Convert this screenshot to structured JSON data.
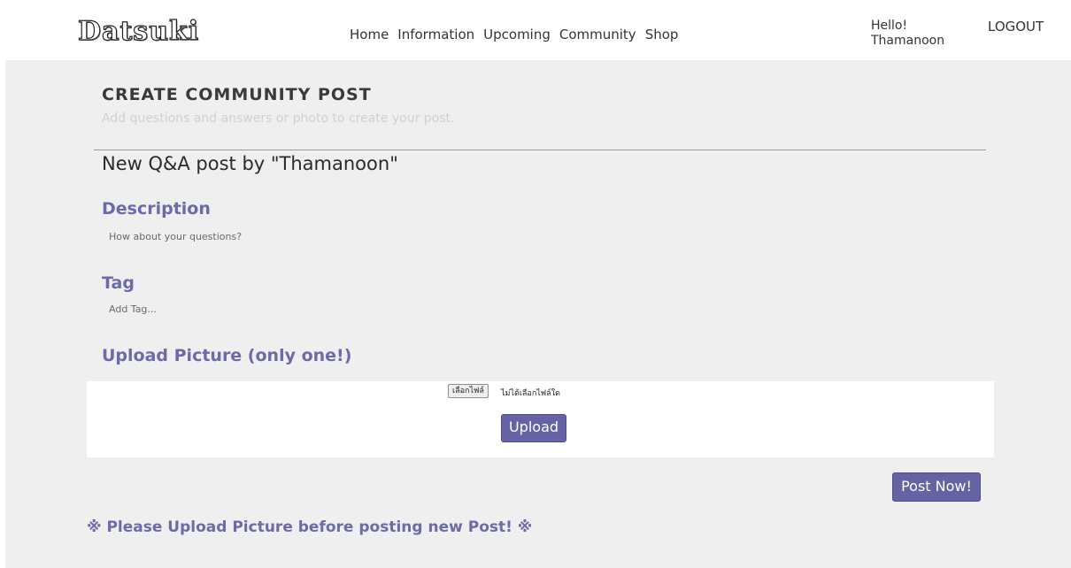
{
  "header": {
    "logo": "Datsuki",
    "nav": [
      "Home",
      "Information",
      "Upcoming",
      "Community",
      "Shop"
    ],
    "greeting_line1": "Hello!",
    "greeting_line2": "Thamanoon",
    "logout": "LOGOUT"
  },
  "page": {
    "title": "Create Community Post",
    "subtitle": "Add questions and answers or photo to create your post.",
    "post_by": "New Q&A post by \"Thamanoon\""
  },
  "form": {
    "description_label": "Description",
    "description_placeholder": "How about your questions?",
    "tag_label": "Tag",
    "tag_placeholder": "Add Tag...",
    "upload_label": "Upload Picture (only one!)",
    "file_button": "เลือกไฟล์",
    "file_status": "ไม่ได้เลือกไฟล์ใด",
    "upload_button": "Upload",
    "post_button": "Post Now!"
  },
  "warning": "※ Please Upload Picture before posting new Post! ※",
  "colors": {
    "accent": "#6563a4",
    "label": "#6d6aaa",
    "panel": "#efefef"
  }
}
